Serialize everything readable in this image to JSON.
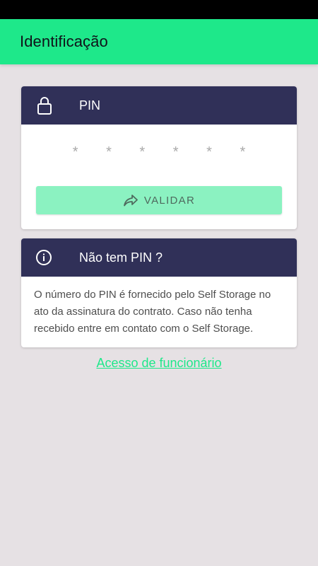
{
  "app_bar": {
    "title": "Identificação",
    "color": "#1ee88a"
  },
  "pin_card": {
    "header_icon": "lock-icon",
    "header_title": "PIN",
    "pin_mask": "* * * * * *",
    "validate_icon": "share-forward-icon",
    "validate_label": "VALIDAR",
    "header_color": "#303058",
    "button_color": "#8bf2c1"
  },
  "info_card": {
    "header_icon": "info-icon",
    "header_title": "Não tem PIN ?",
    "body_text": "O número do PIN é fornecido pelo Self Storage no ato da assinatura do contrato. Caso não tenha recebido entre em contato com o Self Storage."
  },
  "staff_link": {
    "label": "Acesso de funcionário"
  }
}
